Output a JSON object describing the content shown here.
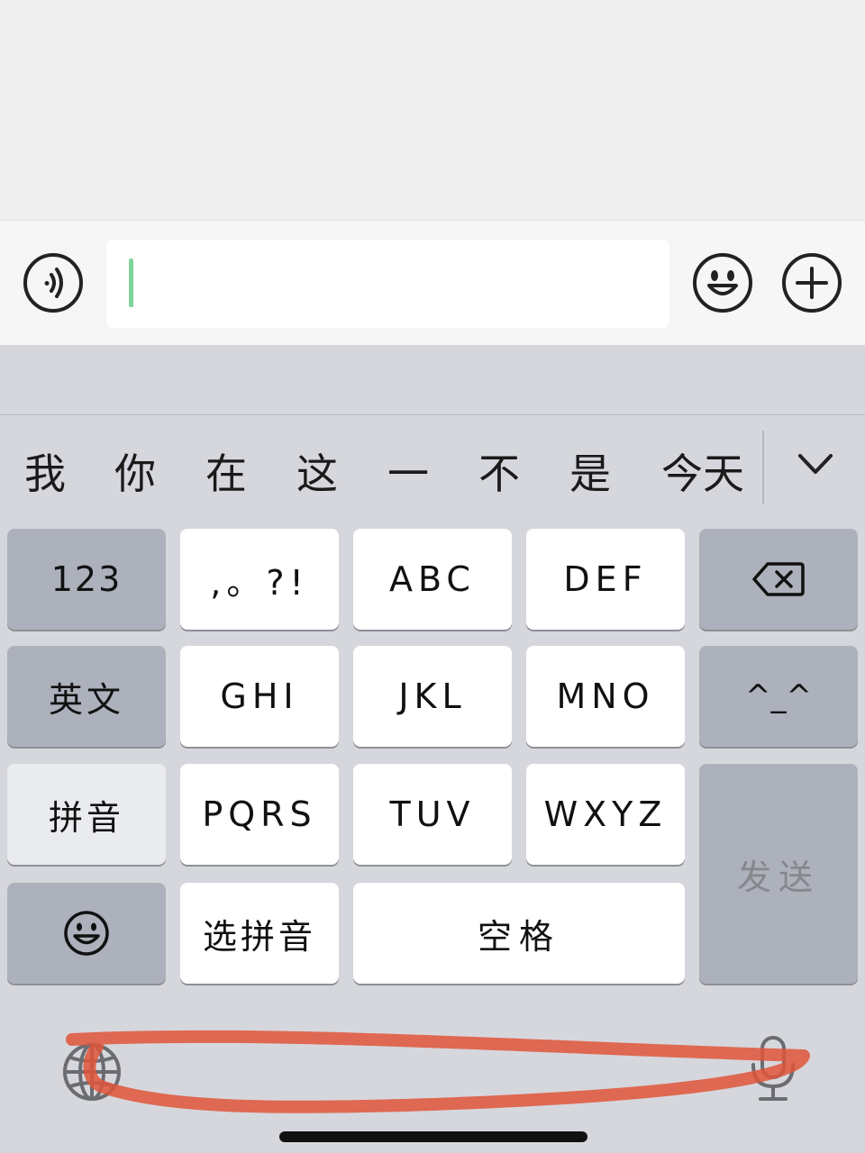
{
  "candidates": [
    "我",
    "你",
    "在",
    "这",
    "一",
    "不",
    "是",
    "今天"
  ],
  "keys": {
    "row1": [
      "123",
      ",。?!",
      "ABC",
      "DEF"
    ],
    "row2": [
      "英文",
      "GHI",
      "JKL",
      "MNO",
      "^_^"
    ],
    "row3": [
      "拼音",
      "PQRS",
      "TUV",
      "WXYZ"
    ],
    "row4": [
      "选拼音",
      "空格"
    ],
    "send": "发送"
  },
  "icons": {
    "voice": "voice-input-icon",
    "emoji": "emoji-icon",
    "plus": "plus-icon",
    "backspace": "backspace-icon",
    "globe": "globe-icon",
    "microphone": "microphone-icon",
    "collapse": "chevron-down-icon"
  },
  "colors": {
    "caret": "#7fd49c",
    "annotation": "#e0553a",
    "keyboard_bg": "#d6d7dc",
    "function_key": "#acb1bb"
  }
}
